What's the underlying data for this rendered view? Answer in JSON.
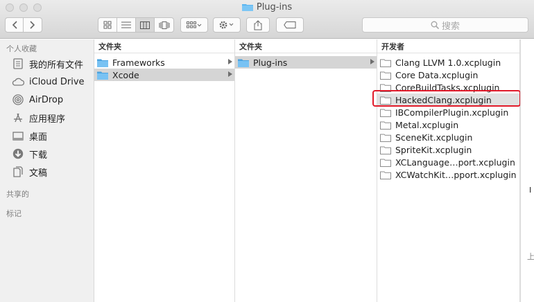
{
  "window": {
    "title": "Plug-ins"
  },
  "toolbar": {
    "search_placeholder": "搜索"
  },
  "sidebar": {
    "sections": [
      {
        "label": "个人收藏"
      },
      {
        "label": "共享的"
      },
      {
        "label": "标记"
      }
    ],
    "items": [
      {
        "label": "我的所有文件",
        "icon": "all-files-icon"
      },
      {
        "label": "iCloud Drive",
        "icon": "cloud-icon"
      },
      {
        "label": "AirDrop",
        "icon": "airdrop-icon"
      },
      {
        "label": "应用程序",
        "icon": "applications-icon"
      },
      {
        "label": "桌面",
        "icon": "desktop-icon"
      },
      {
        "label": "下载",
        "icon": "download-icon"
      },
      {
        "label": "文稿",
        "icon": "documents-icon"
      }
    ]
  },
  "columns": [
    {
      "header": "文件夹",
      "rows": [
        {
          "label": "Frameworks",
          "type": "folder",
          "arrow": true,
          "selected": false
        },
        {
          "label": "Xcode",
          "type": "folder",
          "arrow": true,
          "selected": true
        }
      ]
    },
    {
      "header": "文件夹",
      "rows": [
        {
          "label": "Plug-ins",
          "type": "folder",
          "arrow": true,
          "selected": true
        }
      ]
    },
    {
      "header": "开发者",
      "rows": [
        {
          "label": "Clang LLVM 1.0.xcplugin",
          "type": "plugin"
        },
        {
          "label": "Core Data.xcplugin",
          "type": "plugin"
        },
        {
          "label": "CoreBuildTasks.xcplugin",
          "type": "plugin"
        },
        {
          "label": "HackedClang.xcplugin",
          "type": "plugin",
          "highlighted": true
        },
        {
          "label": "IBCompilerPlugin.xcplugin",
          "type": "plugin"
        },
        {
          "label": "Metal.xcplugin",
          "type": "plugin"
        },
        {
          "label": "SceneKit.xcplugin",
          "type": "plugin"
        },
        {
          "label": "SpriteKit.xcplugin",
          "type": "plugin"
        },
        {
          "label": "XCLanguage…port.xcplugin",
          "type": "plugin"
        },
        {
          "label": "XCWatchKit…pport.xcplugin",
          "type": "plugin"
        }
      ]
    }
  ],
  "edge_glyphs": {
    "mid": "I",
    "bottom": "上"
  },
  "colors": {
    "accent_folder": "#5cb5f0",
    "annotation": "#e11a2a",
    "selection": "#d5d5d5"
  }
}
